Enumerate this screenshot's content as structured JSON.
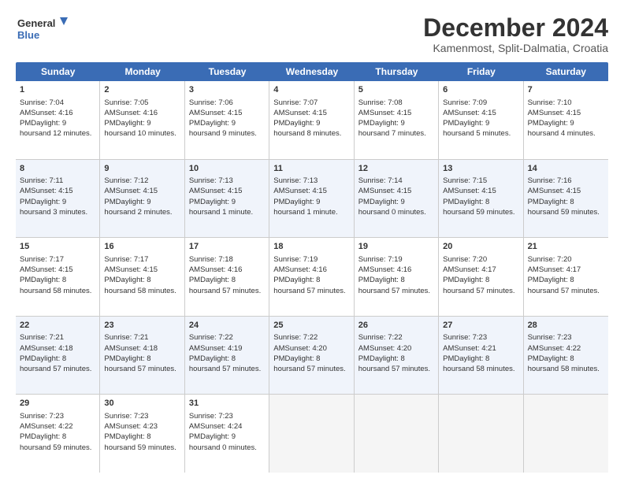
{
  "header": {
    "logo_line1": "General",
    "logo_line2": "Blue",
    "month": "December 2024",
    "location": "Kamenmost, Split-Dalmatia, Croatia"
  },
  "days": [
    "Sunday",
    "Monday",
    "Tuesday",
    "Wednesday",
    "Thursday",
    "Friday",
    "Saturday"
  ],
  "weeks": [
    [
      {
        "day": "1",
        "info": "Sunrise: 7:04 AM\nSunset: 4:16 PM\nDaylight: 9 hours\nand 12 minutes."
      },
      {
        "day": "2",
        "info": "Sunrise: 7:05 AM\nSunset: 4:16 PM\nDaylight: 9 hours\nand 10 minutes."
      },
      {
        "day": "3",
        "info": "Sunrise: 7:06 AM\nSunset: 4:15 PM\nDaylight: 9 hours\nand 9 minutes."
      },
      {
        "day": "4",
        "info": "Sunrise: 7:07 AM\nSunset: 4:15 PM\nDaylight: 9 hours\nand 8 minutes."
      },
      {
        "day": "5",
        "info": "Sunrise: 7:08 AM\nSunset: 4:15 PM\nDaylight: 9 hours\nand 7 minutes."
      },
      {
        "day": "6",
        "info": "Sunrise: 7:09 AM\nSunset: 4:15 PM\nDaylight: 9 hours\nand 5 minutes."
      },
      {
        "day": "7",
        "info": "Sunrise: 7:10 AM\nSunset: 4:15 PM\nDaylight: 9 hours\nand 4 minutes."
      }
    ],
    [
      {
        "day": "8",
        "info": "Sunrise: 7:11 AM\nSunset: 4:15 PM\nDaylight: 9 hours\nand 3 minutes."
      },
      {
        "day": "9",
        "info": "Sunrise: 7:12 AM\nSunset: 4:15 PM\nDaylight: 9 hours\nand 2 minutes."
      },
      {
        "day": "10",
        "info": "Sunrise: 7:13 AM\nSunset: 4:15 PM\nDaylight: 9 hours\nand 1 minute."
      },
      {
        "day": "11",
        "info": "Sunrise: 7:13 AM\nSunset: 4:15 PM\nDaylight: 9 hours\nand 1 minute."
      },
      {
        "day": "12",
        "info": "Sunrise: 7:14 AM\nSunset: 4:15 PM\nDaylight: 9 hours\nand 0 minutes."
      },
      {
        "day": "13",
        "info": "Sunrise: 7:15 AM\nSunset: 4:15 PM\nDaylight: 8 hours\nand 59 minutes."
      },
      {
        "day": "14",
        "info": "Sunrise: 7:16 AM\nSunset: 4:15 PM\nDaylight: 8 hours\nand 59 minutes."
      }
    ],
    [
      {
        "day": "15",
        "info": "Sunrise: 7:17 AM\nSunset: 4:15 PM\nDaylight: 8 hours\nand 58 minutes."
      },
      {
        "day": "16",
        "info": "Sunrise: 7:17 AM\nSunset: 4:15 PM\nDaylight: 8 hours\nand 58 minutes."
      },
      {
        "day": "17",
        "info": "Sunrise: 7:18 AM\nSunset: 4:16 PM\nDaylight: 8 hours\nand 57 minutes."
      },
      {
        "day": "18",
        "info": "Sunrise: 7:19 AM\nSunset: 4:16 PM\nDaylight: 8 hours\nand 57 minutes."
      },
      {
        "day": "19",
        "info": "Sunrise: 7:19 AM\nSunset: 4:16 PM\nDaylight: 8 hours\nand 57 minutes."
      },
      {
        "day": "20",
        "info": "Sunrise: 7:20 AM\nSunset: 4:17 PM\nDaylight: 8 hours\nand 57 minutes."
      },
      {
        "day": "21",
        "info": "Sunrise: 7:20 AM\nSunset: 4:17 PM\nDaylight: 8 hours\nand 57 minutes."
      }
    ],
    [
      {
        "day": "22",
        "info": "Sunrise: 7:21 AM\nSunset: 4:18 PM\nDaylight: 8 hours\nand 57 minutes."
      },
      {
        "day": "23",
        "info": "Sunrise: 7:21 AM\nSunset: 4:18 PM\nDaylight: 8 hours\nand 57 minutes."
      },
      {
        "day": "24",
        "info": "Sunrise: 7:22 AM\nSunset: 4:19 PM\nDaylight: 8 hours\nand 57 minutes."
      },
      {
        "day": "25",
        "info": "Sunrise: 7:22 AM\nSunset: 4:20 PM\nDaylight: 8 hours\nand 57 minutes."
      },
      {
        "day": "26",
        "info": "Sunrise: 7:22 AM\nSunset: 4:20 PM\nDaylight: 8 hours\nand 57 minutes."
      },
      {
        "day": "27",
        "info": "Sunrise: 7:23 AM\nSunset: 4:21 PM\nDaylight: 8 hours\nand 58 minutes."
      },
      {
        "day": "28",
        "info": "Sunrise: 7:23 AM\nSunset: 4:22 PM\nDaylight: 8 hours\nand 58 minutes."
      }
    ],
    [
      {
        "day": "29",
        "info": "Sunrise: 7:23 AM\nSunset: 4:22 PM\nDaylight: 8 hours\nand 59 minutes."
      },
      {
        "day": "30",
        "info": "Sunrise: 7:23 AM\nSunset: 4:23 PM\nDaylight: 8 hours\nand 59 minutes."
      },
      {
        "day": "31",
        "info": "Sunrise: 7:23 AM\nSunset: 4:24 PM\nDaylight: 9 hours\nand 0 minutes."
      },
      {
        "day": "",
        "info": ""
      },
      {
        "day": "",
        "info": ""
      },
      {
        "day": "",
        "info": ""
      },
      {
        "day": "",
        "info": ""
      }
    ]
  ]
}
